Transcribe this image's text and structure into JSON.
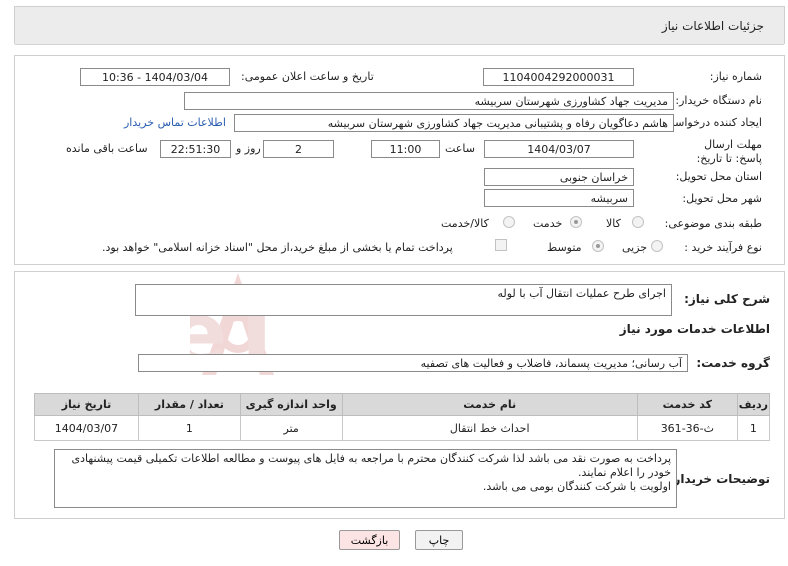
{
  "page": {
    "title": "جزئیات اطلاعات نیاز"
  },
  "labels": {
    "need_number": "شماره نیاز:",
    "announce_datetime": "تاریخ و ساعت اعلان عمومی:",
    "buyer_org": "نام دستگاه خریدار:",
    "requester": "ایجاد کننده درخواست:",
    "deadline": "مهلت ارسال پاسخ: تا تاریخ:",
    "time": "ساعت",
    "day_and": "روز و",
    "time_remaining": "ساعت باقی مانده",
    "province": "استان محل تحویل:",
    "city": "شهر محل تحویل:",
    "category": "طبقه بندی موضوعی:",
    "purchase_type": "نوع فرآیند خرید :",
    "summary": "شرح کلی نیاز:",
    "services_heading": "اطلاعات خدمات مورد نیاز",
    "service_group": "گروه خدمت:",
    "buyer_notes": "توضیحات خریدار:"
  },
  "fields": {
    "need_number": "1104004292000031",
    "announce_datetime": "1404/03/04 - 10:36",
    "buyer_org": "مدیریت جهاد کشاورزی شهرستان سربیشه",
    "requester": "هاشم دعاگویان  رفاه و پشتیبانی مدیریت جهاد کشاورزی شهرستان سربیشه",
    "contact_link": "اطلاعات تماس خریدار",
    "deadline_date": "1404/03/07",
    "deadline_time": "11:00",
    "days": "2",
    "remaining": "22:51:30",
    "province": "خراسان جنوبی",
    "city": "سربیشه",
    "summary": "اجرای طرح عملیات انتقال آب با لوله",
    "service_group": "آب رسانی؛ مدیریت پسماند، فاضلاب و فعالیت های تصفیه"
  },
  "category_options": [
    {
      "label": "کالا",
      "selected": false
    },
    {
      "label": "خدمت",
      "selected": true
    },
    {
      "label": "کالا/خدمت",
      "selected": false
    }
  ],
  "purchase_options": [
    {
      "label": "جزیی",
      "selected": false
    },
    {
      "label": "متوسط",
      "selected": true
    }
  ],
  "payment_checkbox": {
    "label": "پرداخت تمام یا بخشی از مبلغ خرید،از محل \"اسناد خزانه اسلامی\" خواهد بود.",
    "checked": false
  },
  "table": {
    "headers": [
      "ردیف",
      "کد خدمت",
      "نام خدمت",
      "واحد اندازه گیری",
      "تعداد / مقدار",
      "تاریخ نیاز"
    ],
    "rows": [
      [
        "1",
        "ث-36-361",
        "احداث خط انتقال",
        "متر",
        "1",
        "1404/03/07"
      ]
    ]
  },
  "notes": "پرداخت به صورت نقد می باشد لذا شرکت کنندگان محترم با مراجعه به فایل های پیوست و مطالعه اطلاعات تکمیلی قیمت پیشنهادی خودر را اعلام نمایند.\nاولویت با شرکت کنندگان بومی می باشد.",
  "buttons": {
    "print": "چاپ",
    "back": "بازگشت"
  },
  "watermark": {
    "text": "AriaTender.neT"
  },
  "colors": {
    "back_button_bg": "#fde4e4",
    "link": "#2a5db0",
    "watermark": "#e9b7b7"
  }
}
